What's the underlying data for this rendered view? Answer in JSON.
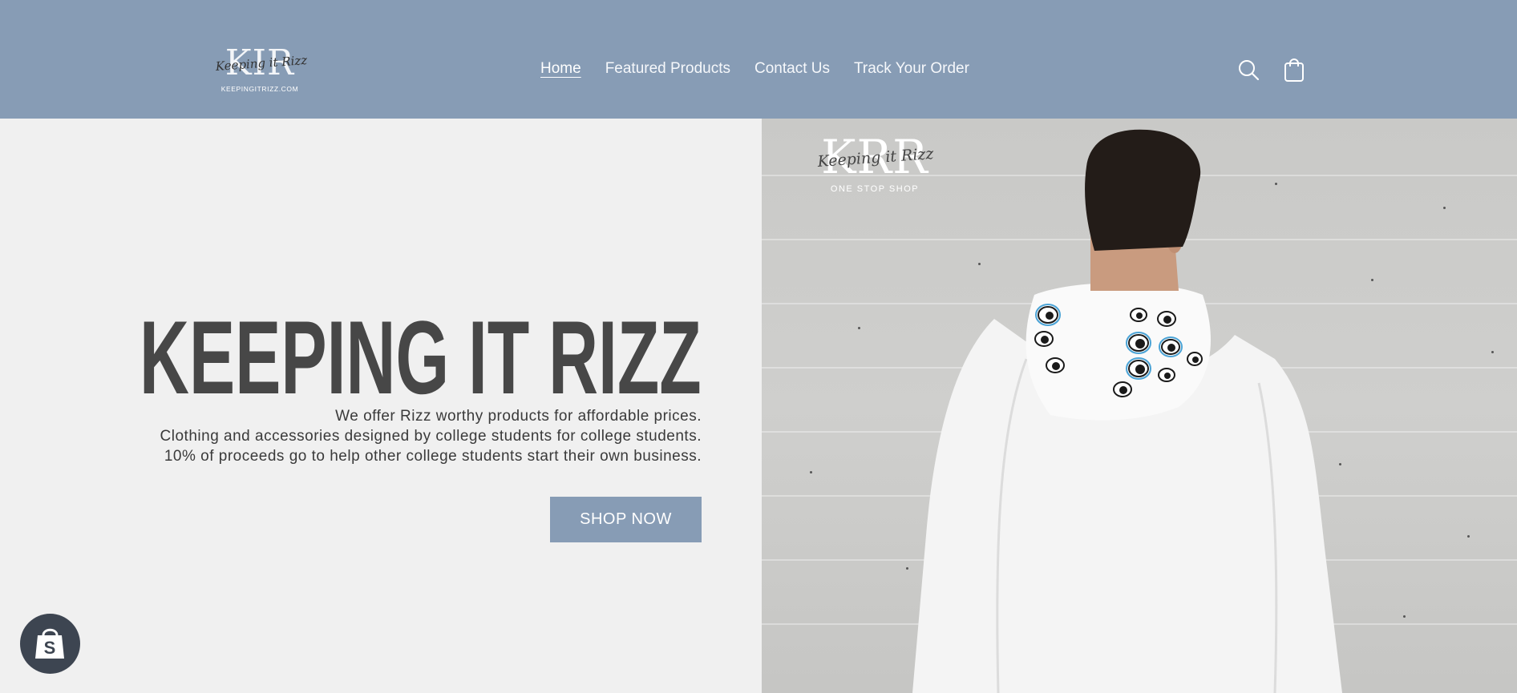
{
  "header": {
    "logo": {
      "initials": "KIR",
      "script": "Keeping it Rizz",
      "url": "KEEPINGITRIZZ.COM"
    },
    "nav": [
      {
        "label": "Home",
        "active": true
      },
      {
        "label": "Featured Products",
        "active": false
      },
      {
        "label": "Contact Us",
        "active": false
      },
      {
        "label": "Track Your Order",
        "active": false
      }
    ],
    "icons": [
      "search-icon",
      "cart-icon"
    ]
  },
  "hero": {
    "title": "KEEPING IT RIZZ",
    "lines": [
      "We offer Rizz worthy products for affordable prices.",
      "Clothing and accessories designed by college students for college students.",
      "10% of proceeds go to help other college students start their own business."
    ],
    "button_label": "SHOP NOW",
    "image_logo": {
      "initials": "KRR",
      "script": "Keeping it Rizz",
      "subtitle": "ONE STOP SHOP"
    }
  },
  "badge": {
    "icon": "shopify-bag-icon",
    "letter": "S"
  },
  "colors": {
    "header_bg": "#879cb5",
    "hero_bg": "#f0f0f0",
    "title": "#474747",
    "button_bg": "#879cb5",
    "badge_bg": "#3d4551"
  }
}
